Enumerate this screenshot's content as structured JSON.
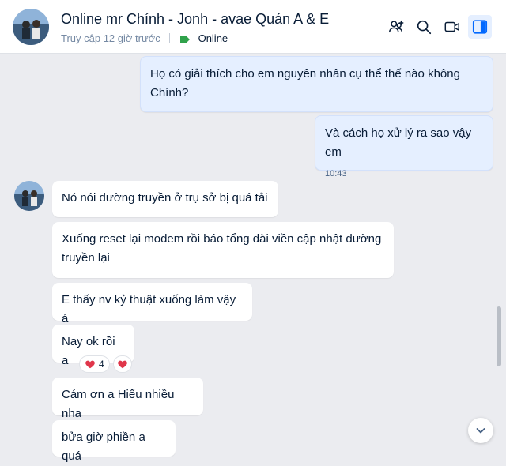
{
  "header": {
    "title": "Online mr Chính - Jonh - avae Quán A & E",
    "last_seen": "Truy cập 12 giờ trước",
    "status": "Online",
    "icons": [
      "add-member-icon",
      "search-icon",
      "video-call-icon",
      "sidebar-toggle-icon"
    ]
  },
  "messages": [
    {
      "direction": "out",
      "text": "Họ có giải thích cho em nguyên nhân cụ thể thế nào không Chính?"
    },
    {
      "direction": "out",
      "text": "Và cách họ xử lý ra sao vậy em",
      "time": "10:43"
    },
    {
      "direction": "in",
      "text": "Nó nói đường truyền ở trụ sở bị quá tải"
    },
    {
      "direction": "in",
      "text": "Xuống reset lại modem rồi báo tổng đài viền cập nhật đường truyền lại"
    },
    {
      "direction": "in",
      "text": "E thấy nv kỷ thuật xuống làm vậy á"
    },
    {
      "direction": "in",
      "text": "Nay ok rồi a"
    },
    {
      "direction": "in",
      "text": "Cám ơn a Hiếu nhiều nha"
    },
    {
      "direction": "in",
      "text": "bửa giờ phiền a quá"
    }
  ],
  "reactions": [
    {
      "icon": "heart-icon",
      "count": "4"
    },
    {
      "icon": "heart-icon",
      "count": ""
    }
  ],
  "colors": {
    "background": "#ebecf0",
    "outgoing_bubble": "#e5efff",
    "incoming_bubble": "#ffffff",
    "online_indicator": "#30a24b",
    "heart": "#e0364a",
    "accent": "#0068ff"
  }
}
